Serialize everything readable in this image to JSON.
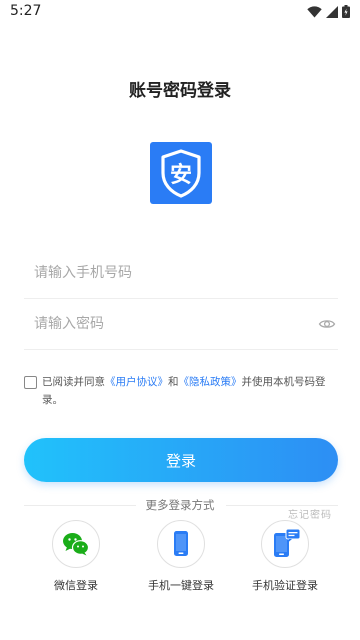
{
  "status_bar": {
    "time": "5:27",
    "icons": [
      "wifi-icon",
      "cellular-signal-icon",
      "battery-icon"
    ]
  },
  "title": "账号密码登录",
  "logo": {
    "icon": "shield-an-logo",
    "glyph": "安",
    "color": "#2a7cf5"
  },
  "phone_field": {
    "placeholder": "请输入手机号码",
    "value": ""
  },
  "password_field": {
    "placeholder": "请输入密码",
    "value": "",
    "icon": "eye-icon"
  },
  "agreement": {
    "checked": false,
    "prefix": "已阅读并同意",
    "user_agreement": "《用户协议》",
    "and": "和",
    "privacy_policy": "《隐私政策》",
    "suffix": "并使用本机号码登录。"
  },
  "login_button": {
    "label": "登录",
    "gradient": [
      "#21c2fb",
      "#2d8ef4"
    ]
  },
  "more_methods": {
    "title": "更多登录方式",
    "overlay_fragment": "忘记密码",
    "items": [
      {
        "label": "微信登录",
        "icon": "wechat-icon",
        "color": "#1aad19"
      },
      {
        "label": "手机一键登录",
        "icon": "phone-icon",
        "color": "#2a7cf5"
      },
      {
        "label": "手机验证登录",
        "icon": "phone-sms-icon",
        "color": "#2a7cf5"
      }
    ]
  }
}
